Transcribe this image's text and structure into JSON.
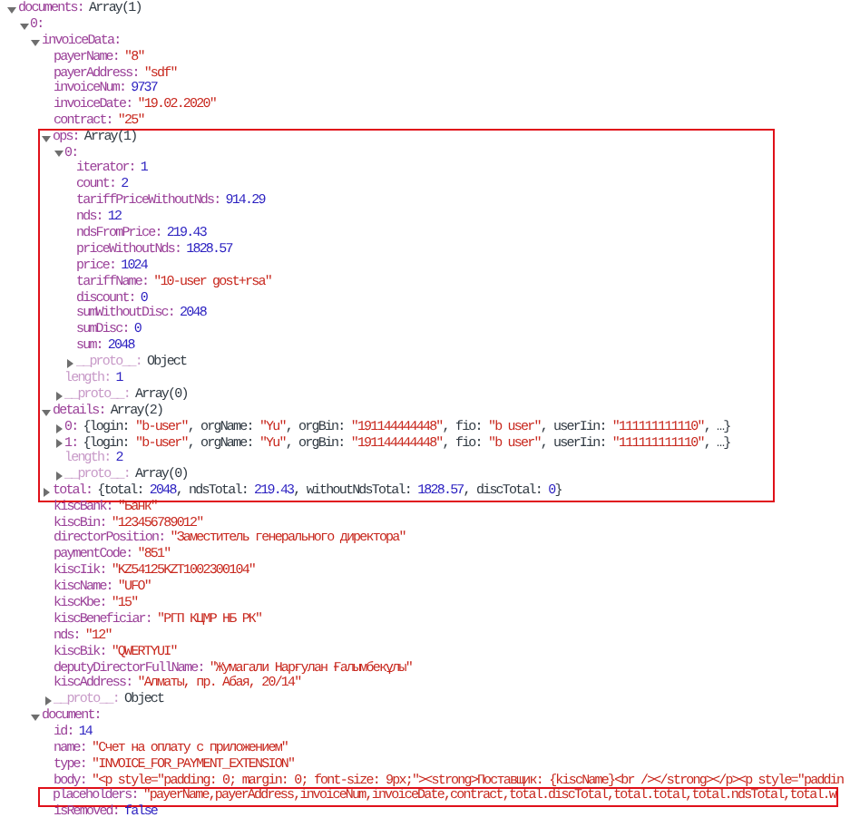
{
  "tree": [
    {
      "key": "documents:",
      "value": "Array(1)",
      "kind": "object",
      "faded": false,
      "expanded": true,
      "children": [
        {
          "key": "0:",
          "faded": false,
          "expanded": true,
          "children": [
            {
              "key": "invoiceData:",
              "faded": false,
              "expanded": true,
              "children": [
                {
                  "key": "payerName:",
                  "value": "\"8\"",
                  "kind": "string",
                  "faded": false
                },
                {
                  "key": "payerAddress:",
                  "value": "\"sdf\"",
                  "kind": "string",
                  "faded": false
                },
                {
                  "key": "invoiceNum:",
                  "value": "9737",
                  "kind": "number",
                  "faded": false
                },
                {
                  "key": "invoiceDate:",
                  "value": "\"19.02.2020\"",
                  "kind": "string",
                  "faded": false
                },
                {
                  "key": "contract:",
                  "value": "\"25\"",
                  "kind": "string",
                  "faded": false
                },
                {
                  "key": "ops:",
                  "value": "Array(1)",
                  "kind": "object",
                  "faded": false,
                  "expanded": true,
                  "highlighted": true,
                  "children": [
                    {
                      "key": "0:",
                      "faded": false,
                      "expanded": true,
                      "children": [
                        {
                          "key": "iterator:",
                          "value": "1",
                          "kind": "number",
                          "faded": false
                        },
                        {
                          "key": "count:",
                          "value": "2",
                          "kind": "number",
                          "faded": false
                        },
                        {
                          "key": "tariffPriceWithoutNds:",
                          "value": "914.29",
                          "kind": "number",
                          "faded": false
                        },
                        {
                          "key": "nds:",
                          "value": "12",
                          "kind": "number",
                          "faded": false
                        },
                        {
                          "key": "ndsFromPrice:",
                          "value": "219.43",
                          "kind": "number",
                          "faded": false
                        },
                        {
                          "key": "priceWithoutNds:",
                          "value": "1828.57",
                          "kind": "number",
                          "faded": false
                        },
                        {
                          "key": "price:",
                          "value": "1024",
                          "kind": "number",
                          "faded": false
                        },
                        {
                          "key": "tariffName:",
                          "value": "\"10-user gost+rsa\"",
                          "kind": "string",
                          "faded": false
                        },
                        {
                          "key": "discount:",
                          "value": "0",
                          "kind": "number",
                          "faded": false
                        },
                        {
                          "key": "sumWithoutDisc:",
                          "value": "2048",
                          "kind": "number",
                          "faded": false
                        },
                        {
                          "key": "sumDisc:",
                          "value": "0",
                          "kind": "number",
                          "faded": false
                        },
                        {
                          "key": "sum:",
                          "value": "2048",
                          "kind": "number",
                          "faded": false
                        },
                        {
                          "key": "__proto__:",
                          "value": "Object",
                          "kind": "object",
                          "faded": true,
                          "expanded": false
                        }
                      ]
                    },
                    {
                      "key": "length:",
                      "value": "1",
                      "kind": "number",
                      "faded": true
                    },
                    {
                      "key": "__proto__:",
                      "value": "Array(0)",
                      "kind": "object",
                      "faded": true,
                      "expanded": false
                    }
                  ]
                },
                {
                  "key": "details:",
                  "value": "Array(2)",
                  "kind": "object",
                  "faded": false,
                  "expanded": true,
                  "highlighted": true,
                  "children": [
                    {
                      "key": "0:",
                      "value": "{login: \"b-user\", orgName: \"Yu\", orgBin: \"191144444448\", fio: \"b user\", userIin: \"111111111110\", …}",
                      "kind": "preview",
                      "faded": false,
                      "expanded": false
                    },
                    {
                      "key": "1:",
                      "value": "{login: \"b-user\", orgName: \"Yu\", orgBin: \"191144444448\", fio: \"b user\", userIin: \"111111111110\", …}",
                      "kind": "preview",
                      "faded": false,
                      "expanded": false
                    },
                    {
                      "key": "length:",
                      "value": "2",
                      "kind": "number",
                      "faded": true
                    },
                    {
                      "key": "__proto__:",
                      "value": "Array(0)",
                      "kind": "object",
                      "faded": true,
                      "expanded": false
                    }
                  ]
                },
                {
                  "key": "total:",
                  "value": "{total: 2048, ndsTotal: 219.43, withoutNdsTotal: 1828.57, discTotal: 0}",
                  "kind": "preview",
                  "faded": false,
                  "expanded": false,
                  "highlighted": true
                },
                {
                  "key": "kiscBank:",
                  "value": "\"Банк\"",
                  "kind": "string",
                  "faded": false
                },
                {
                  "key": "kiscBin:",
                  "value": "\"123456789012\"",
                  "kind": "string",
                  "faded": false
                },
                {
                  "key": "directorPosition:",
                  "value": "\"Заместитель генерального директора\"",
                  "kind": "string",
                  "faded": false
                },
                {
                  "key": "paymentCode:",
                  "value": "\"851\"",
                  "kind": "string",
                  "faded": false
                },
                {
                  "key": "kiscIik:",
                  "value": "\"KZ54125KZT1002300104\"",
                  "kind": "string",
                  "faded": false
                },
                {
                  "key": "kiscName:",
                  "value": "\"UFO\"",
                  "kind": "string",
                  "faded": false
                },
                {
                  "key": "kiscKbe:",
                  "value": "\"15\"",
                  "kind": "string",
                  "faded": false
                },
                {
                  "key": "kiscBeneficiar:",
                  "value": "\"РГП КЦМР НБ РК\"",
                  "kind": "string",
                  "faded": false
                },
                {
                  "key": "nds:",
                  "value": "\"12\"",
                  "kind": "string",
                  "faded": false
                },
                {
                  "key": "kiscBik:",
                  "value": "\"QWERTYUI\"",
                  "kind": "string",
                  "faded": false
                },
                {
                  "key": "deputyDirectorFullName:",
                  "value": "\"Жумагали Нарғулан Ғалымбекұлы\"",
                  "kind": "string",
                  "faded": false
                },
                {
                  "key": "kiscAddress:",
                  "value": "\"Алматы, пр. Абая, 20/14\"",
                  "kind": "string",
                  "faded": false
                },
                {
                  "key": "__proto__:",
                  "value": "Object",
                  "kind": "object",
                  "faded": true,
                  "expanded": false
                }
              ]
            },
            {
              "key": "document:",
              "faded": false,
              "expanded": true,
              "children": [
                {
                  "key": "id:",
                  "value": "14",
                  "kind": "number",
                  "faded": false
                },
                {
                  "key": "name:",
                  "value": "\"Счет на оплату с приложением\"",
                  "kind": "string",
                  "faded": false
                },
                {
                  "key": "type:",
                  "value": "\"INVOICE_FOR_PAYMENT_EXTENSION\"",
                  "kind": "string",
                  "faded": false
                },
                {
                  "key": "body:",
                  "value": "\"<p style=\"padding: 0; margin: 0; font-size: 9px;\"><strong>Поставщик: {kiscName}<br /></strong></p><p style=\"paddin",
                  "kind": "string",
                  "faded": false
                },
                {
                  "key": "placeholders:",
                  "value": "\"payerName,payerAddress,invoiceNum,invoiceDate,contract,total.discTotal,total.total,total.ndsTotal,total.w",
                  "kind": "string",
                  "faded": false,
                  "highlighted": true
                },
                {
                  "key": "isRemoved:",
                  "value": "false",
                  "kind": "boolean",
                  "faded": false
                }
              ]
            }
          ]
        }
      ]
    }
  ]
}
